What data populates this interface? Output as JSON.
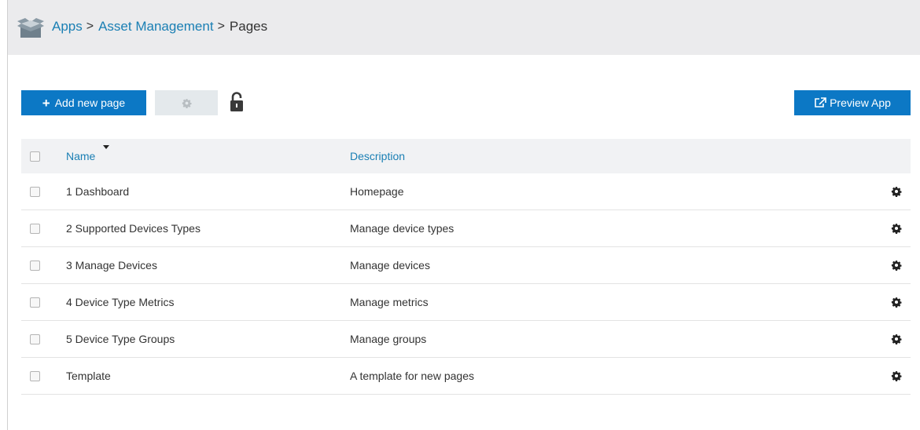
{
  "header": {
    "logo_icon": "folder-open-icon",
    "breadcrumb": [
      {
        "label": "Apps",
        "link": true
      },
      {
        "label": "Asset Management",
        "link": true
      },
      {
        "label": "Pages",
        "link": false
      }
    ],
    "separator": ">"
  },
  "toolbar": {
    "add_label": "Add new page",
    "add_icon": "plus-icon",
    "settings_icon": "gear-icon",
    "lock_icon": "unlocked-padlock-icon",
    "preview_label": "Preview App",
    "preview_icon": "external-link-icon"
  },
  "table": {
    "columns": {
      "name": "Name",
      "description": "Description"
    },
    "sort": {
      "column": "Name",
      "icon": "sort-down-icon"
    },
    "rows": [
      {
        "name": "1 Dashboard",
        "description": "Homepage"
      },
      {
        "name": "2 Supported Devices Types",
        "description": "Manage device types"
      },
      {
        "name": "3 Manage Devices",
        "description": "Manage devices"
      },
      {
        "name": "4 Device Type Metrics",
        "description": "Manage metrics"
      },
      {
        "name": "5 Device Type Groups",
        "description": "Manage groups"
      },
      {
        "name": "Template",
        "description": "A template for new pages"
      }
    ]
  },
  "colors": {
    "primary": "#0c78c5",
    "link": "#1a7fb4",
    "header_bg": "#ebebed",
    "table_header_bg": "#f1f2f4"
  }
}
